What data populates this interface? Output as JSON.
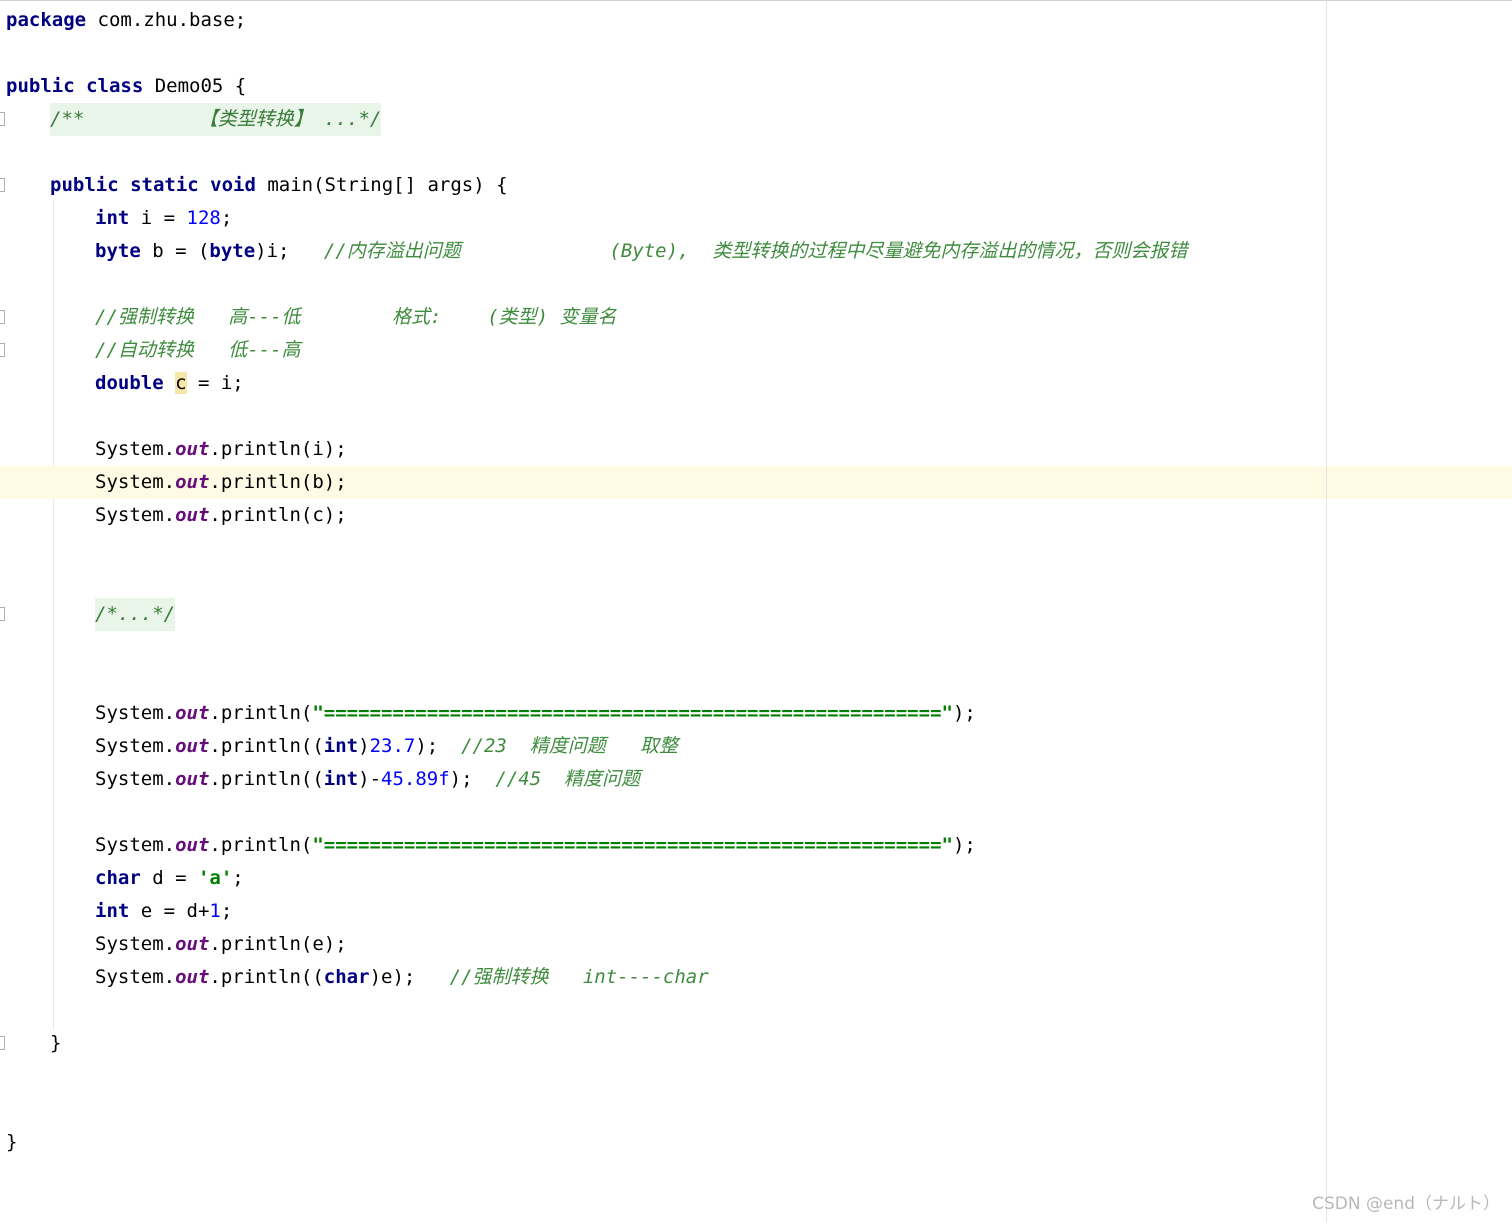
{
  "editor": {
    "lines": {
      "l1": {
        "kw": "package",
        "rest": " com.zhu.base;"
      },
      "l3": {
        "kw": "public class",
        "rest": " Demo05 {"
      },
      "l4": {
        "folded": "/**          【类型转换】 ...*/"
      },
      "l6": {
        "kw": "public static void",
        "rest": " main(String[] args) {"
      },
      "l7": {
        "kw": "int",
        "mid": " i = ",
        "num": "128",
        "end": ";"
      },
      "l8": {
        "kw": "byte",
        "mid": " b = (",
        "kw2": "byte",
        "end": ")i;   ",
        "comment": "//内存溢出问题             (Byte),  类型转换的过程中尽量避免内存溢出的情况，否则会报错"
      },
      "l10": {
        "comment": "//强制转换   高---低        格式:    (类型) 变量名"
      },
      "l11": {
        "comment": "//自动转换   低---高"
      },
      "l12": {
        "kw": "double",
        "sp": " ",
        "var": "c",
        "end": " = i;"
      },
      "l14": {
        "pre": "System.",
        "fld": "out",
        "post": ".println(i);"
      },
      "l15": {
        "pre": "System.",
        "fld": "out",
        "post": ".println(b);"
      },
      "l16": {
        "pre": "System.",
        "fld": "out",
        "post": ".println(c);"
      },
      "l19": {
        "folded": "/*...*/"
      },
      "l22": {
        "pre": "System.",
        "fld": "out",
        "post": ".println(",
        "str": "\"======================================================\"",
        "end": ");"
      },
      "l23": {
        "pre": "System.",
        "fld": "out",
        "post": ".println((",
        "kw": "int",
        "end": ")",
        "num": "23.7",
        "end2": ");  ",
        "comment": "//23  精度问题   取整"
      },
      "l24": {
        "pre": "System.",
        "fld": "out",
        "post": ".println((",
        "kw": "int",
        "end": ")-",
        "num": "45.89f",
        "end2": ");  ",
        "comment": "//45  精度问题"
      },
      "l26": {
        "pre": "System.",
        "fld": "out",
        "post": ".println(",
        "str": "\"======================================================\"",
        "end": ");"
      },
      "l27": {
        "kw": "char",
        "mid": " d = ",
        "str": "'a'",
        "end": ";"
      },
      "l28": {
        "kw": "int",
        "mid": " e = d+",
        "num": "1",
        "end": ";"
      },
      "l29": {
        "pre": "System.",
        "fld": "out",
        "post": ".println(e);"
      },
      "l30": {
        "pre": "System.",
        "fld": "out",
        "post": ".println((",
        "kw": "char",
        "end": ")e);   ",
        "comment": "//强制转换   int----char"
      },
      "l32": {
        "rest": "}"
      },
      "l35": {
        "rest": "}"
      }
    }
  },
  "watermark": "CSDN @end（ナルト）"
}
